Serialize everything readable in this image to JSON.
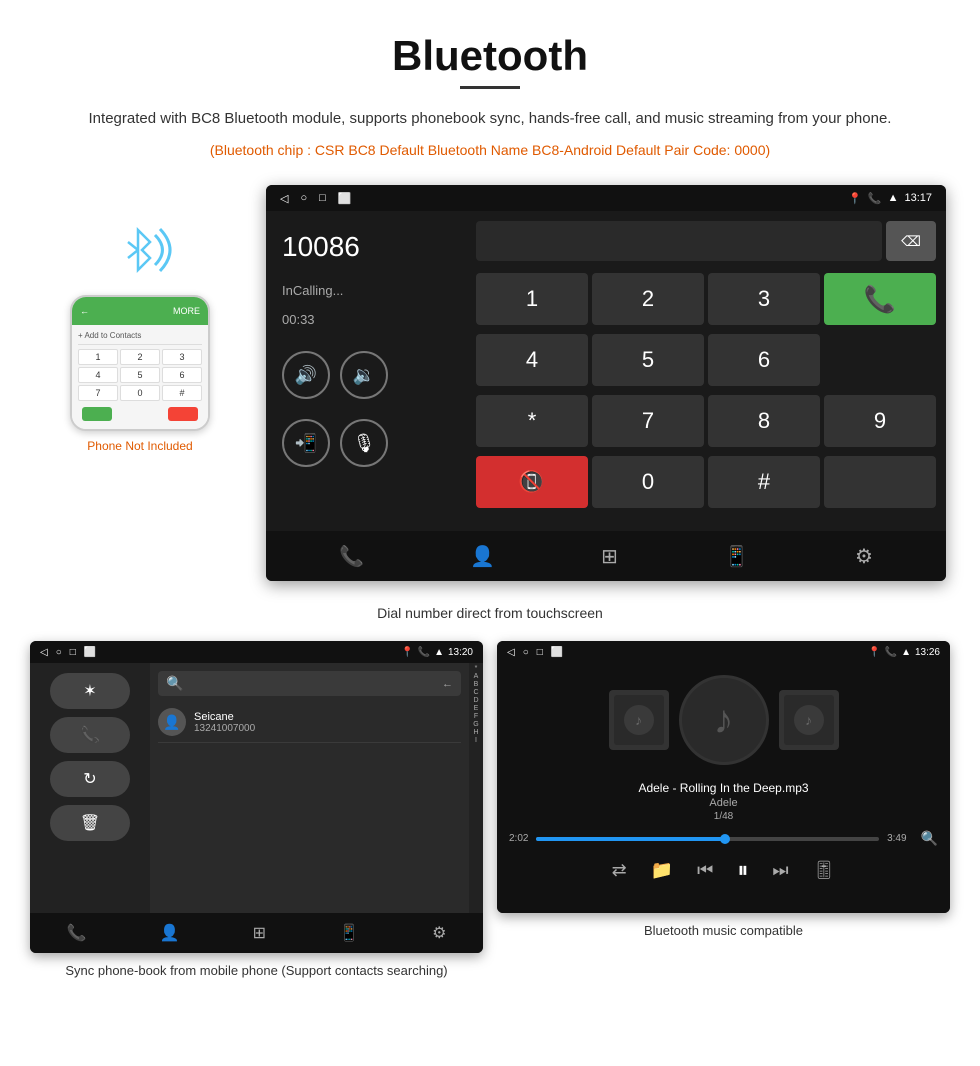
{
  "page": {
    "title": "Bluetooth",
    "description": "Integrated with BC8 Bluetooth module, supports phonebook sync, hands-free call, and music streaming from your phone.",
    "bluetooth_info": "(Bluetooth chip : CSR BC8    Default Bluetooth Name BC8-Android    Default Pair Code: 0000)",
    "phone_label": "Phone Not Included",
    "dial_caption": "Dial number direct from touchscreen",
    "contacts_caption": "Sync phone-book from mobile phone\n(Support contacts searching)",
    "music_caption": "Bluetooth music compatible",
    "dial_number": "10086",
    "dial_status": "InCalling...",
    "dial_timer": "00:33",
    "dial_time": "13:17",
    "contacts_time": "13:20",
    "music_time": "13:26",
    "contact_name": "Seicane",
    "contact_phone": "13241007000",
    "music_song": "Adele - Rolling In the Deep.mp3",
    "music_artist": "Adele",
    "music_track": "1/48",
    "music_current": "2:02",
    "music_total": "3:49",
    "alpha_list": [
      "*",
      "A",
      "B",
      "C",
      "D",
      "E",
      "F",
      "G",
      "H",
      "I"
    ],
    "keypad": [
      "1",
      "2",
      "3",
      "*",
      "4",
      "5",
      "6",
      "0",
      "7",
      "8",
      "9",
      "#"
    ],
    "colors": {
      "accent_orange": "#e05a00",
      "green": "#4caf50",
      "red": "#d32f2f",
      "blue": "#2196f3"
    }
  }
}
